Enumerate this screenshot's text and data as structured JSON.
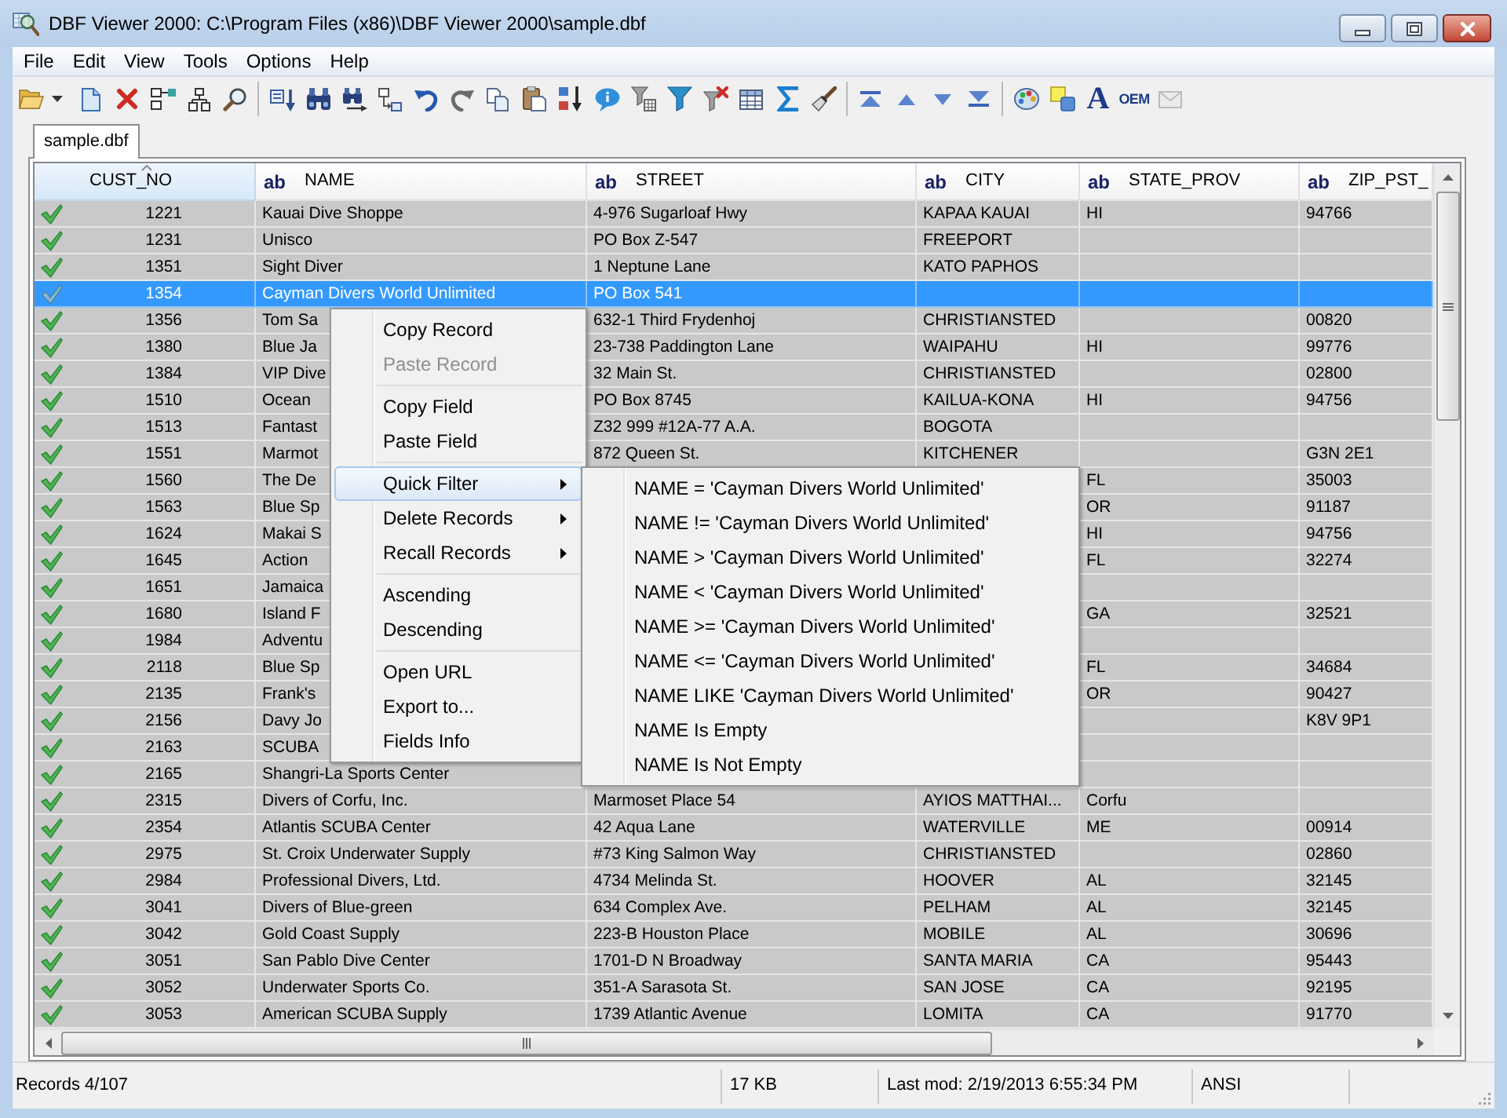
{
  "window": {
    "title": "DBF Viewer 2000: C:\\Program Files (x86)\\DBF Viewer 2000\\sample.dbf"
  },
  "menu_bar": {
    "items": [
      "File",
      "Edit",
      "View",
      "Tools",
      "Options",
      "Help"
    ]
  },
  "toolbar": {
    "items": [
      {
        "kind": "split",
        "disabled": false
      },
      {
        "kind": "icon",
        "disabled": false
      },
      {
        "kind": "icon",
        "disabled": false
      },
      {
        "kind": "icon",
        "disabled": false
      },
      {
        "kind": "icon",
        "disabled": false
      },
      {
        "kind": "icon",
        "disabled": false
      },
      {
        "kind": "separator"
      },
      {
        "kind": "icon",
        "disabled": false
      },
      {
        "kind": "icon",
        "disabled": false
      },
      {
        "kind": "icon",
        "disabled": false
      },
      {
        "kind": "icon",
        "disabled": false
      },
      {
        "kind": "icon",
        "disabled": false
      },
      {
        "kind": "icon",
        "disabled": false
      },
      {
        "kind": "icon",
        "disabled": false
      },
      {
        "kind": "icon",
        "disabled": false
      },
      {
        "kind": "icon",
        "disabled": false
      },
      {
        "kind": "icon",
        "disabled": false
      },
      {
        "kind": "icon",
        "disabled": false
      },
      {
        "kind": "icon",
        "disabled": false
      },
      {
        "kind": "icon",
        "disabled": false
      },
      {
        "kind": "icon",
        "disabled": false
      },
      {
        "kind": "icon",
        "disabled": false
      },
      {
        "kind": "icon",
        "disabled": false
      },
      {
        "kind": "separator"
      },
      {
        "kind": "icon",
        "disabled": false
      },
      {
        "kind": "icon",
        "disabled": false
      },
      {
        "kind": "icon",
        "disabled": false
      },
      {
        "kind": "icon",
        "disabled": false
      },
      {
        "kind": "separator"
      },
      {
        "kind": "icon",
        "disabled": false
      },
      {
        "kind": "icon",
        "disabled": false
      },
      {
        "kind": "letter",
        "label": "A",
        "disabled": false
      },
      {
        "kind": "text",
        "label": "OEM",
        "disabled": false
      },
      {
        "kind": "icon",
        "disabled": true
      }
    ]
  },
  "tabs": [
    {
      "label": "sample.dbf",
      "selected": true
    }
  ],
  "table": {
    "columns": [
      {
        "label": "CUST_NO",
        "sorted": true
      },
      {
        "type_label": "ab",
        "label": "NAME",
        "sorted": false
      },
      {
        "type_label": "ab",
        "label": "STREET",
        "sorted": false
      },
      {
        "type_label": "ab",
        "label": "CITY",
        "sorted": false
      },
      {
        "type_label": "ab",
        "label": "STATE_PROV",
        "sorted": false
      },
      {
        "type_label": "ab",
        "label": "ZIP_PST_",
        "sorted": false
      }
    ],
    "rows": [
      {
        "selected": false,
        "cells": [
          "1221",
          "Kauai Dive Shoppe",
          "4-976 Sugarloaf Hwy",
          "KAPAA KAUAI",
          "HI",
          "94766"
        ]
      },
      {
        "selected": false,
        "cells": [
          "1231",
          "Unisco",
          "PO Box Z-547",
          "FREEPORT",
          null,
          null
        ]
      },
      {
        "selected": false,
        "cells": [
          "1351",
          "Sight Diver",
          "1 Neptune Lane",
          "KATO PAPHOS",
          null,
          null
        ]
      },
      {
        "selected": true,
        "cells": [
          "1354",
          "Cayman Divers World Unlimited",
          "PO Box 541",
          null,
          null,
          null
        ]
      },
      {
        "selected": false,
        "cells": [
          "1356",
          "Tom Sa",
          "632-1 Third Frydenhoj",
          "CHRISTIANSTED",
          null,
          "00820"
        ]
      },
      {
        "selected": false,
        "cells": [
          "1380",
          "Blue Ja",
          "23-738 Paddington Lane",
          "WAIPAHU",
          "HI",
          "99776"
        ]
      },
      {
        "selected": false,
        "cells": [
          "1384",
          "VIP Dive",
          "32 Main St.",
          "CHRISTIANSTED",
          null,
          "02800"
        ]
      },
      {
        "selected": false,
        "cells": [
          "1510",
          "Ocean",
          "PO Box 8745",
          "KAILUA-KONA",
          "HI",
          "94756"
        ]
      },
      {
        "selected": false,
        "cells": [
          "1513",
          "Fantast",
          "Z32 999 #12A-77 A.A.",
          "BOGOTA",
          null,
          null
        ]
      },
      {
        "selected": false,
        "cells": [
          "1551",
          "Marmot",
          "872 Queen St.",
          "KITCHENER",
          null,
          "G3N 2E1"
        ]
      },
      {
        "selected": false,
        "cells": [
          "1560",
          "The De",
          null,
          null,
          "FL",
          "35003"
        ]
      },
      {
        "selected": false,
        "cells": [
          "1563",
          "Blue Sp",
          null,
          null,
          "OR",
          "91187"
        ]
      },
      {
        "selected": false,
        "cells": [
          "1624",
          "Makai S",
          null,
          null,
          "HI",
          "94756"
        ]
      },
      {
        "selected": false,
        "cells": [
          "1645",
          "Action",
          null,
          null,
          "FL",
          "32274"
        ]
      },
      {
        "selected": false,
        "cells": [
          "1651",
          "Jamaica",
          null,
          null,
          null,
          null
        ]
      },
      {
        "selected": false,
        "cells": [
          "1680",
          "Island F",
          null,
          null,
          "GA",
          "32521"
        ]
      },
      {
        "selected": false,
        "cells": [
          "1984",
          "Adventu",
          null,
          null,
          null,
          null
        ]
      },
      {
        "selected": false,
        "cells": [
          "2118",
          "Blue Sp",
          null,
          null,
          "FL",
          "34684"
        ]
      },
      {
        "selected": false,
        "cells": [
          "2135",
          "Frank's",
          null,
          null,
          "OR",
          "90427"
        ]
      },
      {
        "selected": false,
        "cells": [
          "2156",
          "Davy Jo",
          null,
          null,
          null,
          "K8V 9P1"
        ]
      },
      {
        "selected": false,
        "cells": [
          "2163",
          "SCUBA",
          null,
          null,
          null,
          null
        ]
      },
      {
        "selected": false,
        "cells": [
          "2165",
          "Shangri-La Sports Center",
          null,
          null,
          null,
          null
        ]
      },
      {
        "selected": false,
        "cells": [
          "2315",
          "Divers of Corfu, Inc.",
          "Marmoset Place 54",
          "AYIOS MATTHAI...",
          "Corfu",
          null
        ]
      },
      {
        "selected": false,
        "cells": [
          "2354",
          "Atlantis SCUBA Center",
          "42 Aqua Lane",
          "WATERVILLE",
          "ME",
          "00914"
        ]
      },
      {
        "selected": false,
        "cells": [
          "2975",
          "St. Croix Underwater Supply",
          "#73 King Salmon Way",
          "CHRISTIANSTED",
          null,
          "02860"
        ]
      },
      {
        "selected": false,
        "cells": [
          "2984",
          "Professional Divers, Ltd.",
          "4734 Melinda St.",
          "HOOVER",
          "AL",
          "32145"
        ]
      },
      {
        "selected": false,
        "cells": [
          "3041",
          "Divers of Blue-green",
          "634 Complex Ave.",
          "PELHAM",
          "AL",
          "32145"
        ]
      },
      {
        "selected": false,
        "cells": [
          "3042",
          "Gold Coast Supply",
          "223-B Houston Place",
          "MOBILE",
          "AL",
          "30696"
        ]
      },
      {
        "selected": false,
        "cells": [
          "3051",
          "San Pablo Dive Center",
          "1701-D N Broadway",
          "SANTA MARIA",
          "CA",
          "95443"
        ]
      },
      {
        "selected": false,
        "cells": [
          "3052",
          "Underwater Sports Co.",
          "351-A Sarasota St.",
          "SAN JOSE",
          "CA",
          "92195"
        ]
      },
      {
        "selected": false,
        "cells": [
          "3053",
          "American SCUBA Supply",
          "1739 Atlantic Avenue",
          "LOMITA",
          "CA",
          "91770"
        ]
      }
    ]
  },
  "context_menu": {
    "items": [
      {
        "kind": "item",
        "label": "Copy Record",
        "disabled": false,
        "selected": false,
        "has_submenu": false
      },
      {
        "kind": "item",
        "label": "Paste Record",
        "disabled": true,
        "selected": false,
        "has_submenu": false
      },
      {
        "kind": "separator"
      },
      {
        "kind": "item",
        "label": "Copy Field",
        "disabled": false,
        "selected": false,
        "has_submenu": false
      },
      {
        "kind": "item",
        "label": "Paste Field",
        "disabled": false,
        "selected": false,
        "has_submenu": false
      },
      {
        "kind": "separator"
      },
      {
        "kind": "item",
        "label": "Quick Filter",
        "disabled": false,
        "selected": true,
        "has_submenu": true
      },
      {
        "kind": "item",
        "label": "Delete Records",
        "disabled": false,
        "selected": false,
        "has_submenu": true
      },
      {
        "kind": "item",
        "label": "Recall Records",
        "disabled": false,
        "selected": false,
        "has_submenu": true
      },
      {
        "kind": "separator"
      },
      {
        "kind": "item",
        "label": "Ascending",
        "disabled": false,
        "selected": false,
        "has_submenu": false
      },
      {
        "kind": "item",
        "label": "Descending",
        "disabled": false,
        "selected": false,
        "has_submenu": false
      },
      {
        "kind": "separator"
      },
      {
        "kind": "item",
        "label": "Open URL",
        "disabled": false,
        "selected": false,
        "has_submenu": false
      },
      {
        "kind": "item",
        "label": "Export to...",
        "disabled": false,
        "selected": false,
        "has_submenu": false
      },
      {
        "kind": "item",
        "label": "Fields Info",
        "disabled": false,
        "selected": false,
        "has_submenu": false
      }
    ]
  },
  "submenu": {
    "items": [
      {
        "label": "NAME = 'Cayman Divers World Unlimited'",
        "selected": false
      },
      {
        "label": "NAME != 'Cayman Divers World Unlimited'",
        "selected": false
      },
      {
        "label": "NAME > 'Cayman Divers World Unlimited'",
        "selected": false
      },
      {
        "label": "NAME < 'Cayman Divers World Unlimited'",
        "selected": false
      },
      {
        "label": "NAME >= 'Cayman Divers World Unlimited'",
        "selected": false
      },
      {
        "label": "NAME <= 'Cayman Divers World Unlimited'",
        "selected": false
      },
      {
        "label": "NAME LIKE 'Cayman Divers World Unlimited'",
        "selected": false
      },
      {
        "label": "NAME Is Empty",
        "selected": false
      },
      {
        "label": "NAME Is Not Empty",
        "selected": false
      }
    ]
  },
  "status_bar": {
    "panels": [
      "Records 4/107",
      "17 KB",
      "Last mod: 2/19/2013 6:55:34 PM",
      "ANSI"
    ]
  }
}
